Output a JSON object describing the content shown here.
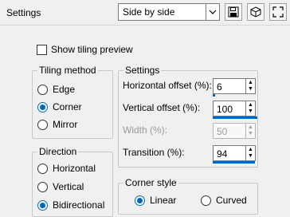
{
  "toolbar": {
    "title": "Settings",
    "preset_value": "Side by side",
    "icons": [
      "chevron-down-icon",
      "save-icon",
      "cube-icon",
      "expand-icon"
    ]
  },
  "options": {
    "show_tiling_preview_label": "Show tiling preview",
    "show_tiling_preview_checked": false
  },
  "tiling_method": {
    "title": "Tiling method",
    "items": [
      {
        "label": "Edge",
        "selected": false
      },
      {
        "label": "Corner",
        "selected": true
      },
      {
        "label": "Mirror",
        "selected": false
      }
    ]
  },
  "direction": {
    "title": "Direction",
    "items": [
      {
        "label": "Horizontal",
        "selected": false
      },
      {
        "label": "Vertical",
        "selected": false
      },
      {
        "label": "Bidirectional",
        "selected": true
      }
    ]
  },
  "settings": {
    "title": "Settings",
    "fields": [
      {
        "label": "Horizontal offset (%):",
        "value": "6",
        "enabled": true,
        "level": 0.06
      },
      {
        "label": "Vertical offset (%):",
        "value": "100",
        "enabled": true,
        "level": 1.0
      },
      {
        "label": "Width (%):",
        "value": "50",
        "enabled": false,
        "level": 0.5
      },
      {
        "label": "Transition (%):",
        "value": "94",
        "enabled": true,
        "level": 0.94
      }
    ]
  },
  "corner_style": {
    "title": "Corner style",
    "items": [
      {
        "label": "Linear",
        "selected": true
      },
      {
        "label": "Curved",
        "selected": false
      }
    ]
  },
  "colors": {
    "accent": "#0067c0",
    "background": "#f0f0f0"
  }
}
